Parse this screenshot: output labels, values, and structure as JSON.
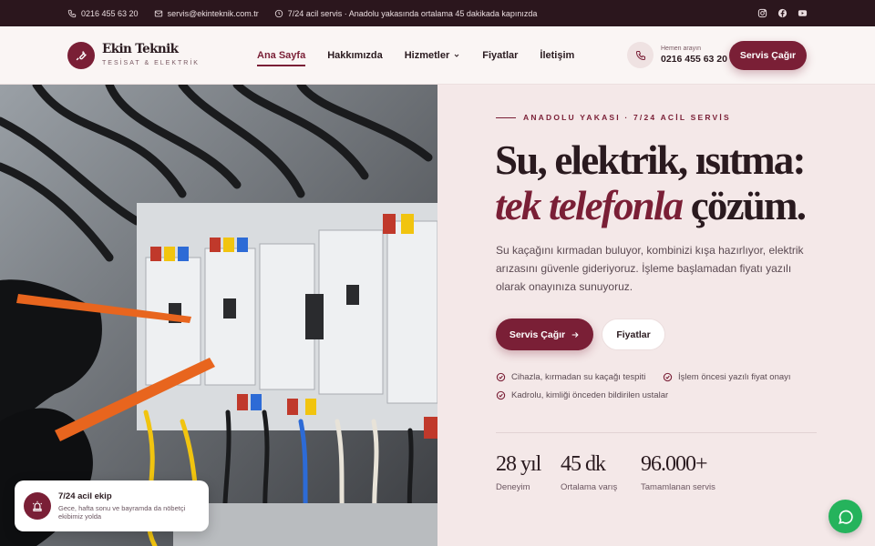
{
  "topbar": {
    "phone": "0216 455 63 20",
    "email": "servis@ekinteknik.com.tr",
    "notice": "7/24 acil servis · Anadolu yakasında ortalama 45 dakikada kapınızda",
    "social": [
      "instagram-icon",
      "facebook-icon",
      "youtube-icon"
    ]
  },
  "brand": {
    "name": "Ekin Teknik",
    "tagline": "TESİSAT & ELEKTRİK",
    "accent": "#7a1f36"
  },
  "nav": {
    "items": [
      {
        "label": "Ana Sayfa",
        "active": true
      },
      {
        "label": "Hakkımızda"
      },
      {
        "label": "Hizmetler",
        "dropdown": true
      },
      {
        "label": "Fiyatlar"
      },
      {
        "label": "İletişim"
      }
    ]
  },
  "header": {
    "call_small": "Hemen arayın",
    "call_number": "0216 455 63 20",
    "cta": "Servis Çağır"
  },
  "hero": {
    "eyebrow": "ANADOLU YAKASI · 7/24 ACİL SERVİS",
    "title_line1": "Su, elektrik, ısıtma:",
    "title_emph": "tek telefonla",
    "title_end": " çözüm.",
    "lead": "Su kaçağını kırmadan buluyor, kombinizi kışa hazırlıyor, elektrik arızasını güvenle gideriyoruz. İşleme başlamadan fiyatı yazılı olarak onayınıza sunuyoruz.",
    "primary_button": "Servis Çağır",
    "secondary_button": "Fiyatlar",
    "checks": [
      "Cihazla, kırmadan su kaçağı tespiti",
      "İşlem öncesi yazılı fiyat onayı",
      "Kadrolu, kimliği önceden bildirilen ustalar"
    ],
    "stats": [
      {
        "value": "28 yıl",
        "label": "Deneyim"
      },
      {
        "value": "45 dk",
        "label": "Ortalama varış"
      },
      {
        "value": "96.000+",
        "label": "Tamamlanan servis"
      }
    ]
  },
  "info_card": {
    "title": "7/24 acil ekip",
    "text": "Gece, hafta sonu ve bayramda da nöbetçi ekibimiz yolda"
  }
}
